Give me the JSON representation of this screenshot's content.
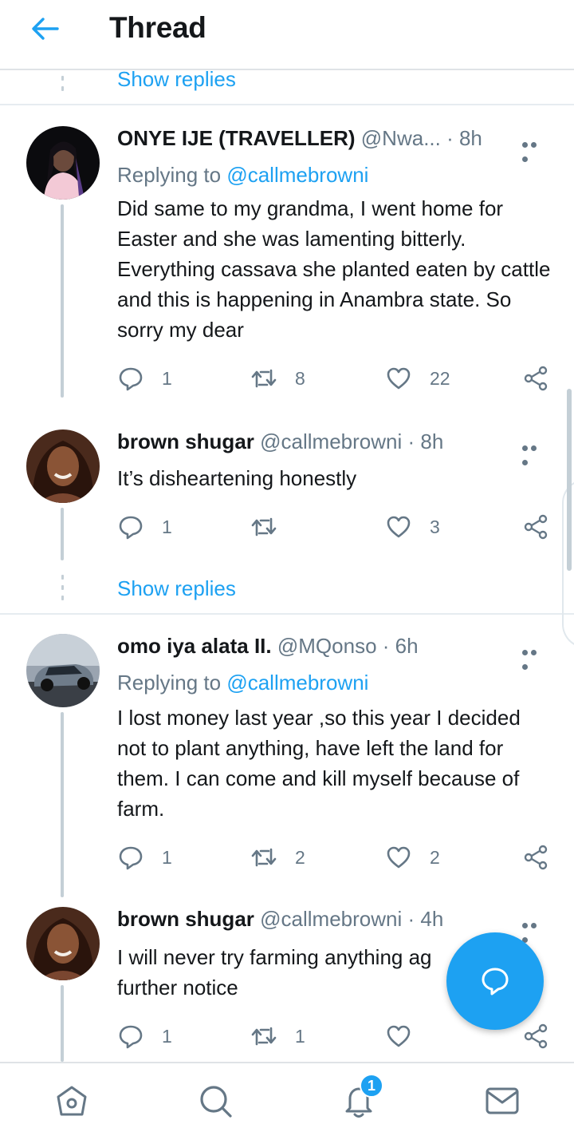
{
  "header": {
    "title": "Thread"
  },
  "show_replies_top": "Show replies",
  "show_replies_mid": "Show replies",
  "tweets": [
    {
      "name": "ONYE IJE (TRAVELLER)",
      "handle": "@Nwa...",
      "time": "· 8h",
      "replying_prefix": "Replying to",
      "replying_to": "@callmebrowni",
      "text": "Did same to my grandma, I went home for Easter and she was lamenting bitterly. Everything cassava she planted eaten by cattle and this is happening in Anambra state. So sorry my dear",
      "replies": "1",
      "retweets": "8",
      "likes": "22"
    },
    {
      "name": "brown shugar",
      "handle": "@callmebrowni",
      "time": "· 8h",
      "text": "It’s disheartening honestly",
      "replies": "1",
      "retweets": "",
      "likes": "3"
    },
    {
      "name": "omo iya alata II.",
      "handle": "@MQonso",
      "time": "· 6h",
      "replying_prefix": "Replying to",
      "replying_to": "@callmebrowni",
      "text": "I lost money last year ,so this year I decided not to plant anything, have left the land for them. I can come and kill myself because of farm.",
      "replies": "1",
      "retweets": "2",
      "likes": "2"
    },
    {
      "name": "brown shugar",
      "handle": "@callmebrowni",
      "time": "· 4h",
      "text": "I will never try farming anything ag further notice",
      "replies": "1",
      "retweets": "1",
      "likes": ""
    }
  ],
  "nav": {
    "notification_count": "1"
  },
  "colors": {
    "accent": "#1da1f2",
    "muted": "#657786",
    "text": "#14171a",
    "divider": "#e6ecf0"
  },
  "icons": [
    "back-arrow-icon",
    "more-icon",
    "reply-icon",
    "retweet-icon",
    "like-icon",
    "share-icon",
    "compose-message-icon",
    "home-icon",
    "search-icon",
    "notifications-icon",
    "messages-icon"
  ]
}
